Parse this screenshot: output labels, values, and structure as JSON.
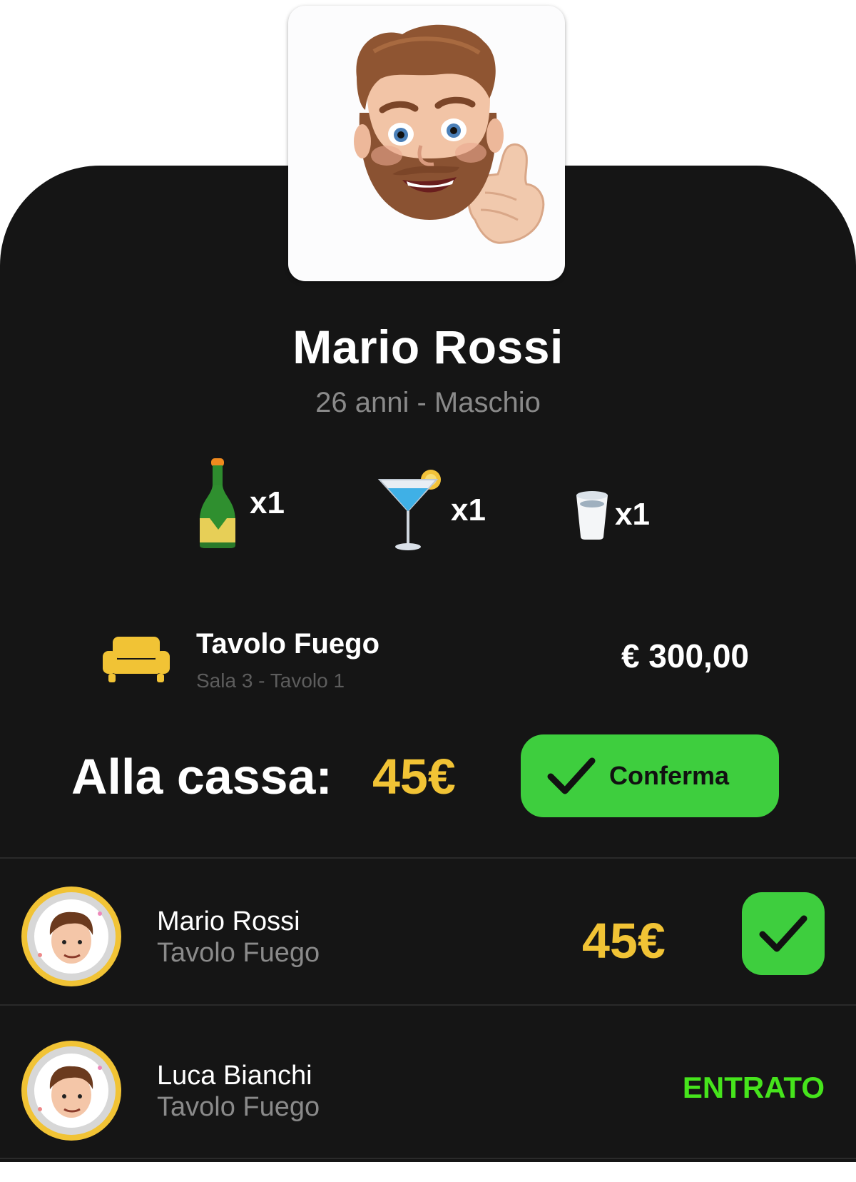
{
  "profile": {
    "name": "Mario Rossi",
    "subtitle": "26 anni - Maschio",
    "avatar_icon": "memoji-thumbs-up-icon"
  },
  "drinks": [
    {
      "icon": "champagne-bottle-icon",
      "qty": "x1"
    },
    {
      "icon": "cocktail-glass-icon",
      "qty": "x1"
    },
    {
      "icon": "cup-icon",
      "qty": "x1"
    }
  ],
  "table": {
    "icon": "sofa-icon",
    "name": "Tavolo Fuego",
    "sub": "Sala 3 - Tavolo 1",
    "price": "€ 300,00"
  },
  "cassa": {
    "label": "Alla cassa:",
    "amount": "45€"
  },
  "confirm": {
    "label": "Conferma",
    "icon": "check-icon"
  },
  "guests": [
    {
      "name": "Mario Rossi",
      "table": "Tavolo Fuego",
      "amount": "45€",
      "action_icon": "check-icon"
    },
    {
      "name": "Luca Bianchi",
      "table": "Tavolo Fuego",
      "status": "ENTRATO"
    }
  ],
  "colors": {
    "background": "#151515",
    "accent_yellow": "#f1c335",
    "accent_green": "#3ece3e",
    "status_green": "#46e41c"
  }
}
